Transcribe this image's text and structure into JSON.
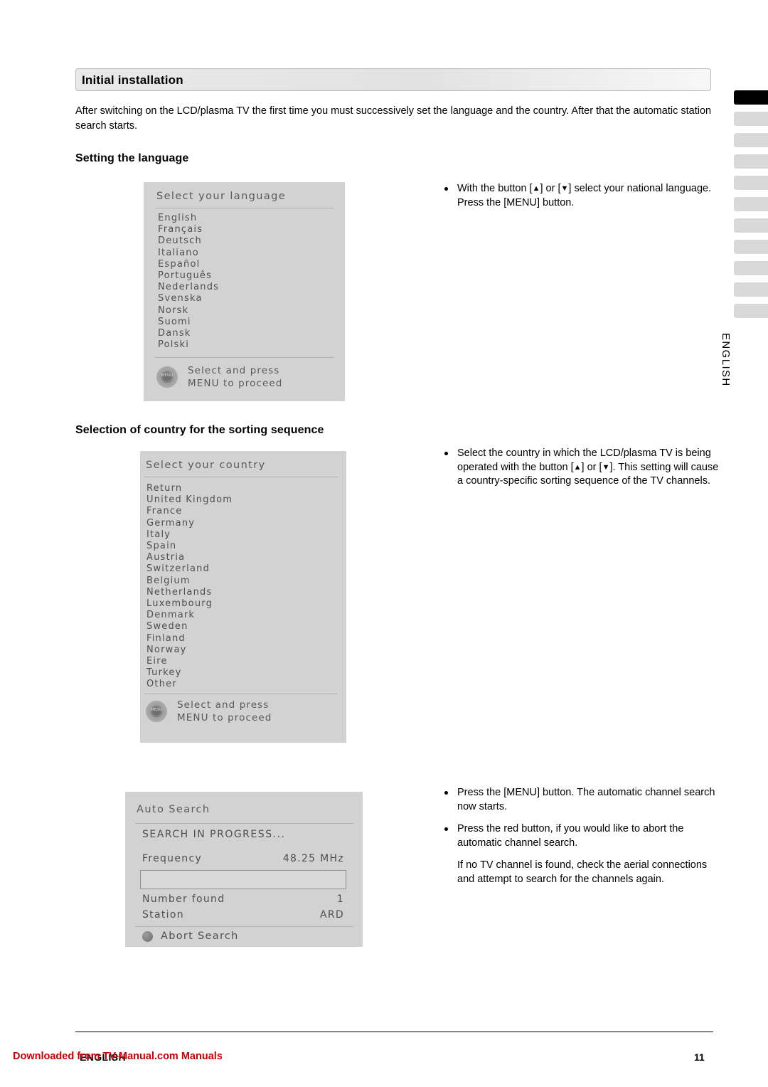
{
  "page": {
    "title": "Initial installation",
    "intro": "After switching on the LCD/plasma TV the first time you must successively set the language and the country. After that the automatic station search starts.",
    "heading_language": "Setting the language",
    "heading_country": "Selection of country for the sorting sequence"
  },
  "osd_language": {
    "title": "Select your language",
    "items": [
      "English",
      "Français",
      "Deutsch",
      "Italiano",
      "Español",
      "Português",
      "Nederlands",
      "Svenska",
      "Norsk",
      "Suomi",
      "Dansk",
      "Polski"
    ],
    "footer_line1": "Select and press",
    "footer_line2": "MENU to proceed",
    "navpad_label": "MENU"
  },
  "osd_country": {
    "title": "Select your country",
    "items": [
      "Return",
      "United Kingdom",
      "France",
      "Germany",
      "Italy",
      "Spain",
      "Austria",
      "Switzerland",
      "Belgium",
      "Netherlands",
      "Luxembourg",
      "Denmark",
      "Sweden",
      "Finland",
      "Norway",
      "Eire",
      "Turkey",
      "Other"
    ],
    "footer_line1": "Select and press",
    "footer_line2": "MENU to proceed",
    "navpad_label": "MENU"
  },
  "osd_search": {
    "title": "Auto Search",
    "progress": "SEARCH IN PROGRESS...",
    "frequency_label": "Frequency",
    "frequency_value": "48.25 MHz",
    "number_found_label": "Number found",
    "number_found_value": "1",
    "station_label": "Station",
    "station_value": "ARD",
    "abort_label": "Abort Search"
  },
  "text_language": {
    "bullet1_a": "With the button [",
    "bullet1_up": "▲",
    "bullet1_b": "] or [",
    "bullet1_down": "▼",
    "bullet1_c": "] select your national language. Press the [MENU] button."
  },
  "text_country": {
    "bullet1_a": "Select the country in which the LCD/plasma TV is being operated with the button [",
    "bullet1_up": "▲",
    "bullet1_b": "] or [",
    "bullet1_down": "▼",
    "bullet1_c": "]. This setting will cause a country-specific sorting sequence of the TV channels."
  },
  "text_search": {
    "bullet1": "Press the [MENU] button. The automatic channel search now starts.",
    "bullet2": "Press the red button, if you would like to abort the automatic channel search.",
    "paragraph": "If no TV channel is found, check the aerial connections and attempt to search for the channels again."
  },
  "side": {
    "english_label": "ENGLISH",
    "tab_count": 10,
    "active_tab_index": 0
  },
  "footer": {
    "language": "ENGLISH",
    "page_number": "11",
    "watermark": "Downloaded from TV-Manual.com Manuals"
  },
  "colors": {
    "osd_background": "#d2d2d2",
    "watermark": "#cc0000",
    "tab_active": "#000000",
    "tab_inactive": "#d9d9d9"
  }
}
